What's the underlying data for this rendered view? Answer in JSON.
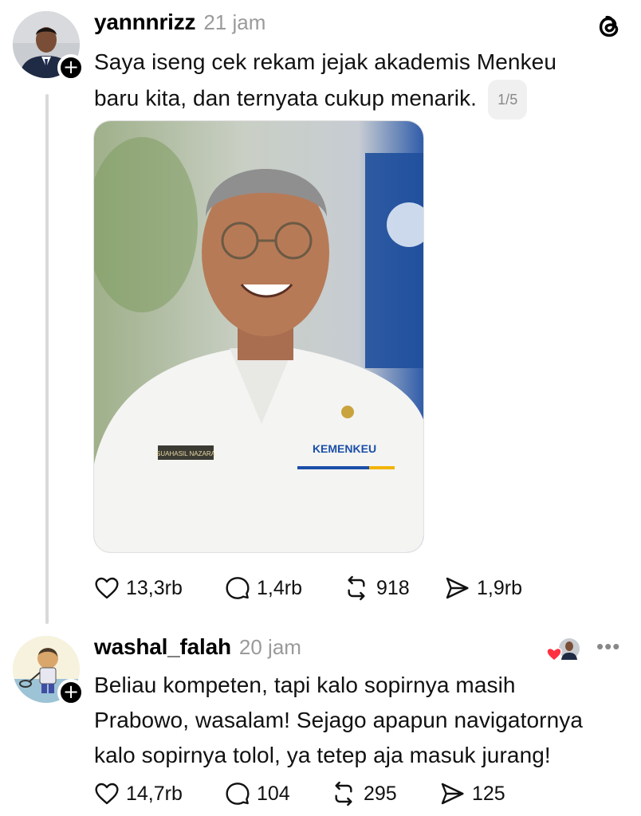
{
  "post1": {
    "username": "yannnrizz",
    "time": "21 jam",
    "text_line1": "Saya iseng cek rekam jejak akademis Menkeu",
    "text_line2": "baru kita, dan ternyata cukup menarik.",
    "pager": "1/5",
    "image": {
      "name_tag": "SUAHASIL NAZARA",
      "logo": "KEMENKEU"
    },
    "actions": {
      "likes": "13,3rb",
      "replies": "1,4rb",
      "reposts": "918",
      "shares": "1,9rb"
    }
  },
  "post2": {
    "username": "washal_falah",
    "time": "20 jam",
    "text_line1": "Beliau kompeten, tapi kalo sopirnya masih",
    "text_line2": "Prabowo, wasalam! Sejago apapun navigatornya",
    "text_line3": "kalo sopirnya tolol, ya tetep aja masuk jurang!",
    "more": "•••",
    "actions": {
      "likes": "14,7rb",
      "replies": "104",
      "reposts": "295",
      "shares": "125"
    }
  },
  "icons": {
    "like": "heart-icon",
    "reply": "comment-icon",
    "repost": "repost-icon",
    "share": "send-icon",
    "app": "threads-logo-icon"
  },
  "colors": {
    "accent_heart": "#ff3040",
    "muted": "#9a9a9a",
    "thread_line": "#d9d9d9"
  }
}
